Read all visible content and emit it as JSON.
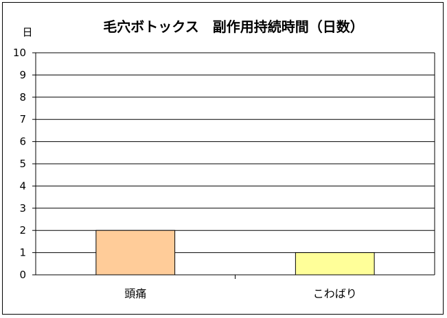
{
  "chart_data": {
    "type": "bar",
    "title": "毛穴ボトックス　副作用持続時間（日数）",
    "ylabel": "日",
    "xlabel": "",
    "categories": [
      "頭痛",
      "こわばり"
    ],
    "values": [
      2,
      1
    ],
    "colors": [
      "#FFCC99",
      "#FFFF99"
    ],
    "ylim": [
      0,
      10
    ],
    "yticks": [
      "0",
      "1",
      "2",
      "3",
      "4",
      "5",
      "6",
      "7",
      "8",
      "9",
      "10"
    ],
    "grid": true,
    "legend": "none"
  }
}
